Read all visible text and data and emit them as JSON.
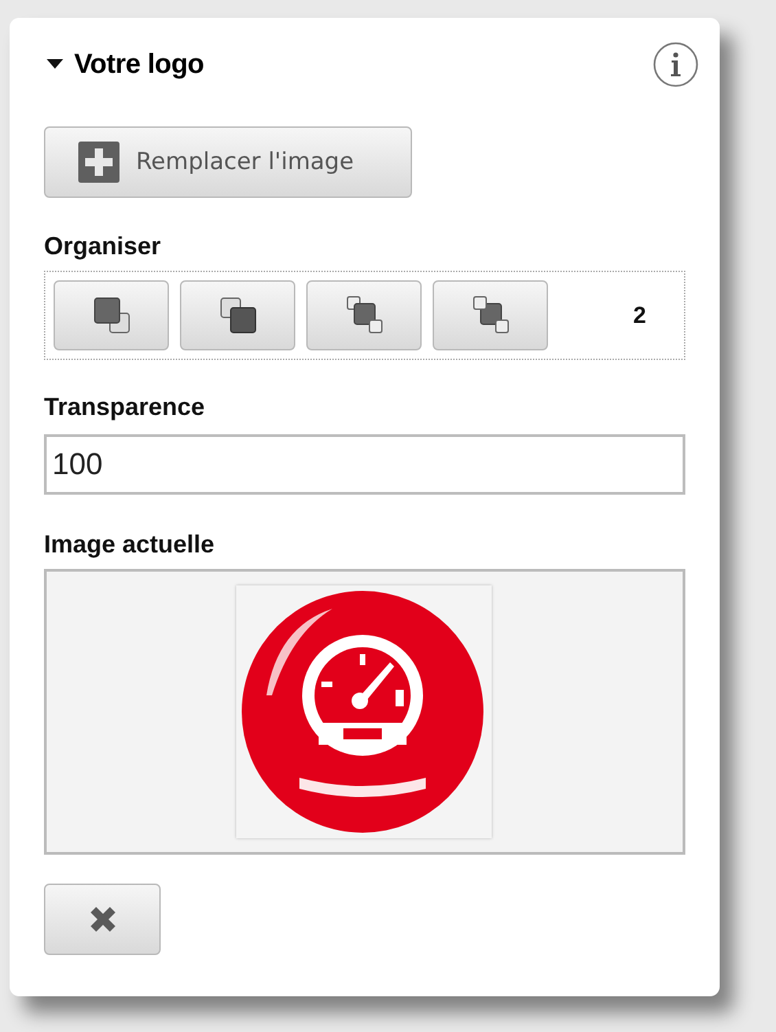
{
  "section": {
    "title": "Votre logo",
    "expanded": true
  },
  "replace_button": {
    "label": "Remplacer l'image"
  },
  "organize": {
    "label": "Organiser",
    "buttons": [
      {
        "kind": "front"
      },
      {
        "kind": "back"
      },
      {
        "kind": "forward"
      },
      {
        "kind": "backward"
      }
    ],
    "value": "2"
  },
  "transparency": {
    "label": "Transparence",
    "value": "100"
  },
  "current_image": {
    "label": "Image actuelle",
    "kind": "picture"
  }
}
